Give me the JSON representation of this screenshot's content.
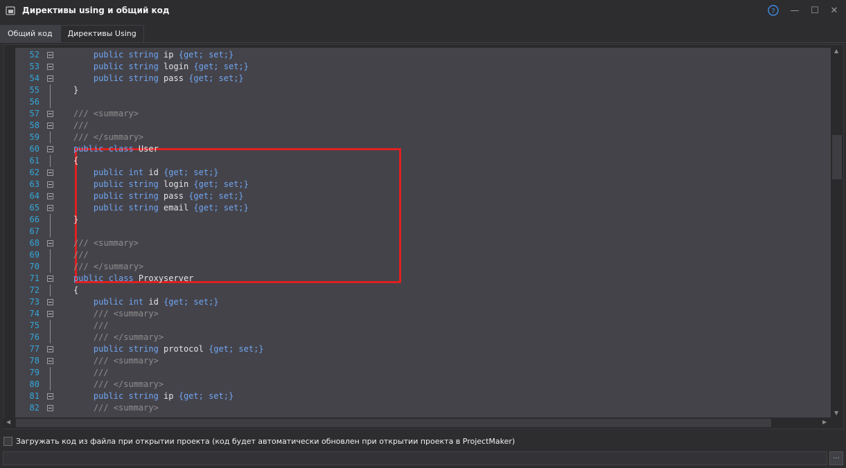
{
  "window": {
    "title": "Директивы using и общий код",
    "buttons": {
      "help": "?",
      "minimize": "—",
      "maximize": "☐",
      "close": "✕"
    }
  },
  "tabs": [
    {
      "label": "Общий код",
      "active": true
    },
    {
      "label": "Директивы Using",
      "active": false
    }
  ],
  "editor": {
    "colors": {
      "background": "#45434a",
      "line_number": "#32a8d8",
      "keyword": "#6ea6f2",
      "comment": "#8e8e8e",
      "comment_text": "#3faa3f",
      "highlight_border": "#e02020"
    },
    "lines": [
      {
        "n": "52",
        "indent": "    ",
        "kw": "public string",
        "text": " ip ",
        "acc": "{get; set;}",
        "cm": "",
        "cmg": ""
      },
      {
        "n": "53",
        "indent": "    ",
        "kw": "public string",
        "text": " login ",
        "acc": "{get; set;}",
        "cm": "",
        "cmg": ""
      },
      {
        "n": "54",
        "indent": "    ",
        "kw": "public string",
        "text": " pass ",
        "acc": "{get; set;}",
        "cm": "",
        "cmg": ""
      },
      {
        "n": "55",
        "indent": "",
        "kw": "",
        "text": "}",
        "acc": "",
        "cm": "",
        "cmg": ""
      },
      {
        "n": "56",
        "indent": "",
        "kw": "",
        "text": "",
        "acc": "",
        "cm": "",
        "cmg": ""
      },
      {
        "n": "57",
        "indent": "",
        "kw": "",
        "text": "",
        "acc": "",
        "cm": "/// <summary>",
        "cmg": ""
      },
      {
        "n": "58",
        "indent": "",
        "kw": "",
        "text": "",
        "acc": "",
        "cm": "/// ",
        "cmg": ""
      },
      {
        "n": "59",
        "indent": "",
        "kw": "",
        "text": "",
        "acc": "",
        "cm": "/// </summary>",
        "cmg": ""
      },
      {
        "n": "60",
        "indent": "",
        "kw": "public class",
        "text": " User",
        "acc": "",
        "cm": "",
        "cmg": ""
      },
      {
        "n": "61",
        "indent": "",
        "kw": "",
        "text": "{",
        "acc": "",
        "cm": "",
        "cmg": ""
      },
      {
        "n": "62",
        "indent": "    ",
        "kw": "public int",
        "text": " id ",
        "acc": "{get; set;}",
        "cm": "",
        "cmg": ""
      },
      {
        "n": "63",
        "indent": "    ",
        "kw": "public string",
        "text": " login ",
        "acc": "{get; set;}",
        "cm": "",
        "cmg": ""
      },
      {
        "n": "64",
        "indent": "    ",
        "kw": "public string",
        "text": " pass ",
        "acc": "{get; set;}",
        "cm": "",
        "cmg": ""
      },
      {
        "n": "65",
        "indent": "    ",
        "kw": "public string",
        "text": " email ",
        "acc": "{get; set;}",
        "cm": "",
        "cmg": ""
      },
      {
        "n": "66",
        "indent": "",
        "kw": "",
        "text": "}",
        "acc": "",
        "cm": "",
        "cmg": ""
      },
      {
        "n": "67",
        "indent": "",
        "kw": "",
        "text": "",
        "acc": "",
        "cm": "",
        "cmg": ""
      },
      {
        "n": "68",
        "indent": "",
        "kw": "",
        "text": "",
        "acc": "",
        "cm": "/// <summary>",
        "cmg": ""
      },
      {
        "n": "69",
        "indent": "",
        "kw": "",
        "text": "",
        "acc": "",
        "cm": "/// ",
        "cmg": ""
      },
      {
        "n": "70",
        "indent": "",
        "kw": "",
        "text": "",
        "acc": "",
        "cm": "/// </summary>",
        "cmg": ""
      },
      {
        "n": "71",
        "indent": "",
        "kw": "public class",
        "text": " Proxyserver",
        "acc": "",
        "cm": "",
        "cmg": ""
      },
      {
        "n": "72",
        "indent": "",
        "kw": "",
        "text": "{",
        "acc": "",
        "cm": "",
        "cmg": ""
      },
      {
        "n": "73",
        "indent": "    ",
        "kw": "public int",
        "text": " id ",
        "acc": "{get; set;}",
        "cm": "",
        "cmg": ""
      },
      {
        "n": "74",
        "indent": "    ",
        "kw": "",
        "text": "",
        "acc": "",
        "cm": "/// <summary>",
        "cmg": ""
      },
      {
        "n": "75",
        "indent": "    ",
        "kw": "",
        "text": "",
        "acc": "",
        "cm": "/// ",
        "cmg": ""
      },
      {
        "n": "76",
        "indent": "    ",
        "kw": "",
        "text": "",
        "acc": "",
        "cm": "/// </summary>",
        "cmg": ""
      },
      {
        "n": "77",
        "indent": "    ",
        "kw": "public string",
        "text": " protocol ",
        "acc": "{get; set;}",
        "cm": "",
        "cmg": ""
      },
      {
        "n": "78",
        "indent": "    ",
        "kw": "",
        "text": "",
        "acc": "",
        "cm": "/// <summary>",
        "cmg": ""
      },
      {
        "n": "79",
        "indent": "    ",
        "kw": "",
        "text": "",
        "acc": "",
        "cm": "/// ",
        "cmg": ""
      },
      {
        "n": "80",
        "indent": "    ",
        "kw": "",
        "text": "",
        "acc": "",
        "cm": "/// </summary>",
        "cmg": ""
      },
      {
        "n": "81",
        "indent": "    ",
        "kw": "public string",
        "text": " ip ",
        "acc": "{get; set;}",
        "cm": "",
        "cmg": ""
      },
      {
        "n": "82",
        "indent": "    ",
        "kw": "",
        "text": "",
        "acc": "",
        "cm": "/// <summary>",
        "cmg": ""
      }
    ]
  },
  "scroll": {
    "up": "▲",
    "down": "▼",
    "left": "◀",
    "right": "▶"
  },
  "footer": {
    "load_from_file_label": "Загружать код из файла при открытии проекта (код будет автоматически обновлен при открытии проекта в ProjectMaker)",
    "load_from_file_checked": false,
    "path_value": "",
    "browse_label": "..."
  }
}
